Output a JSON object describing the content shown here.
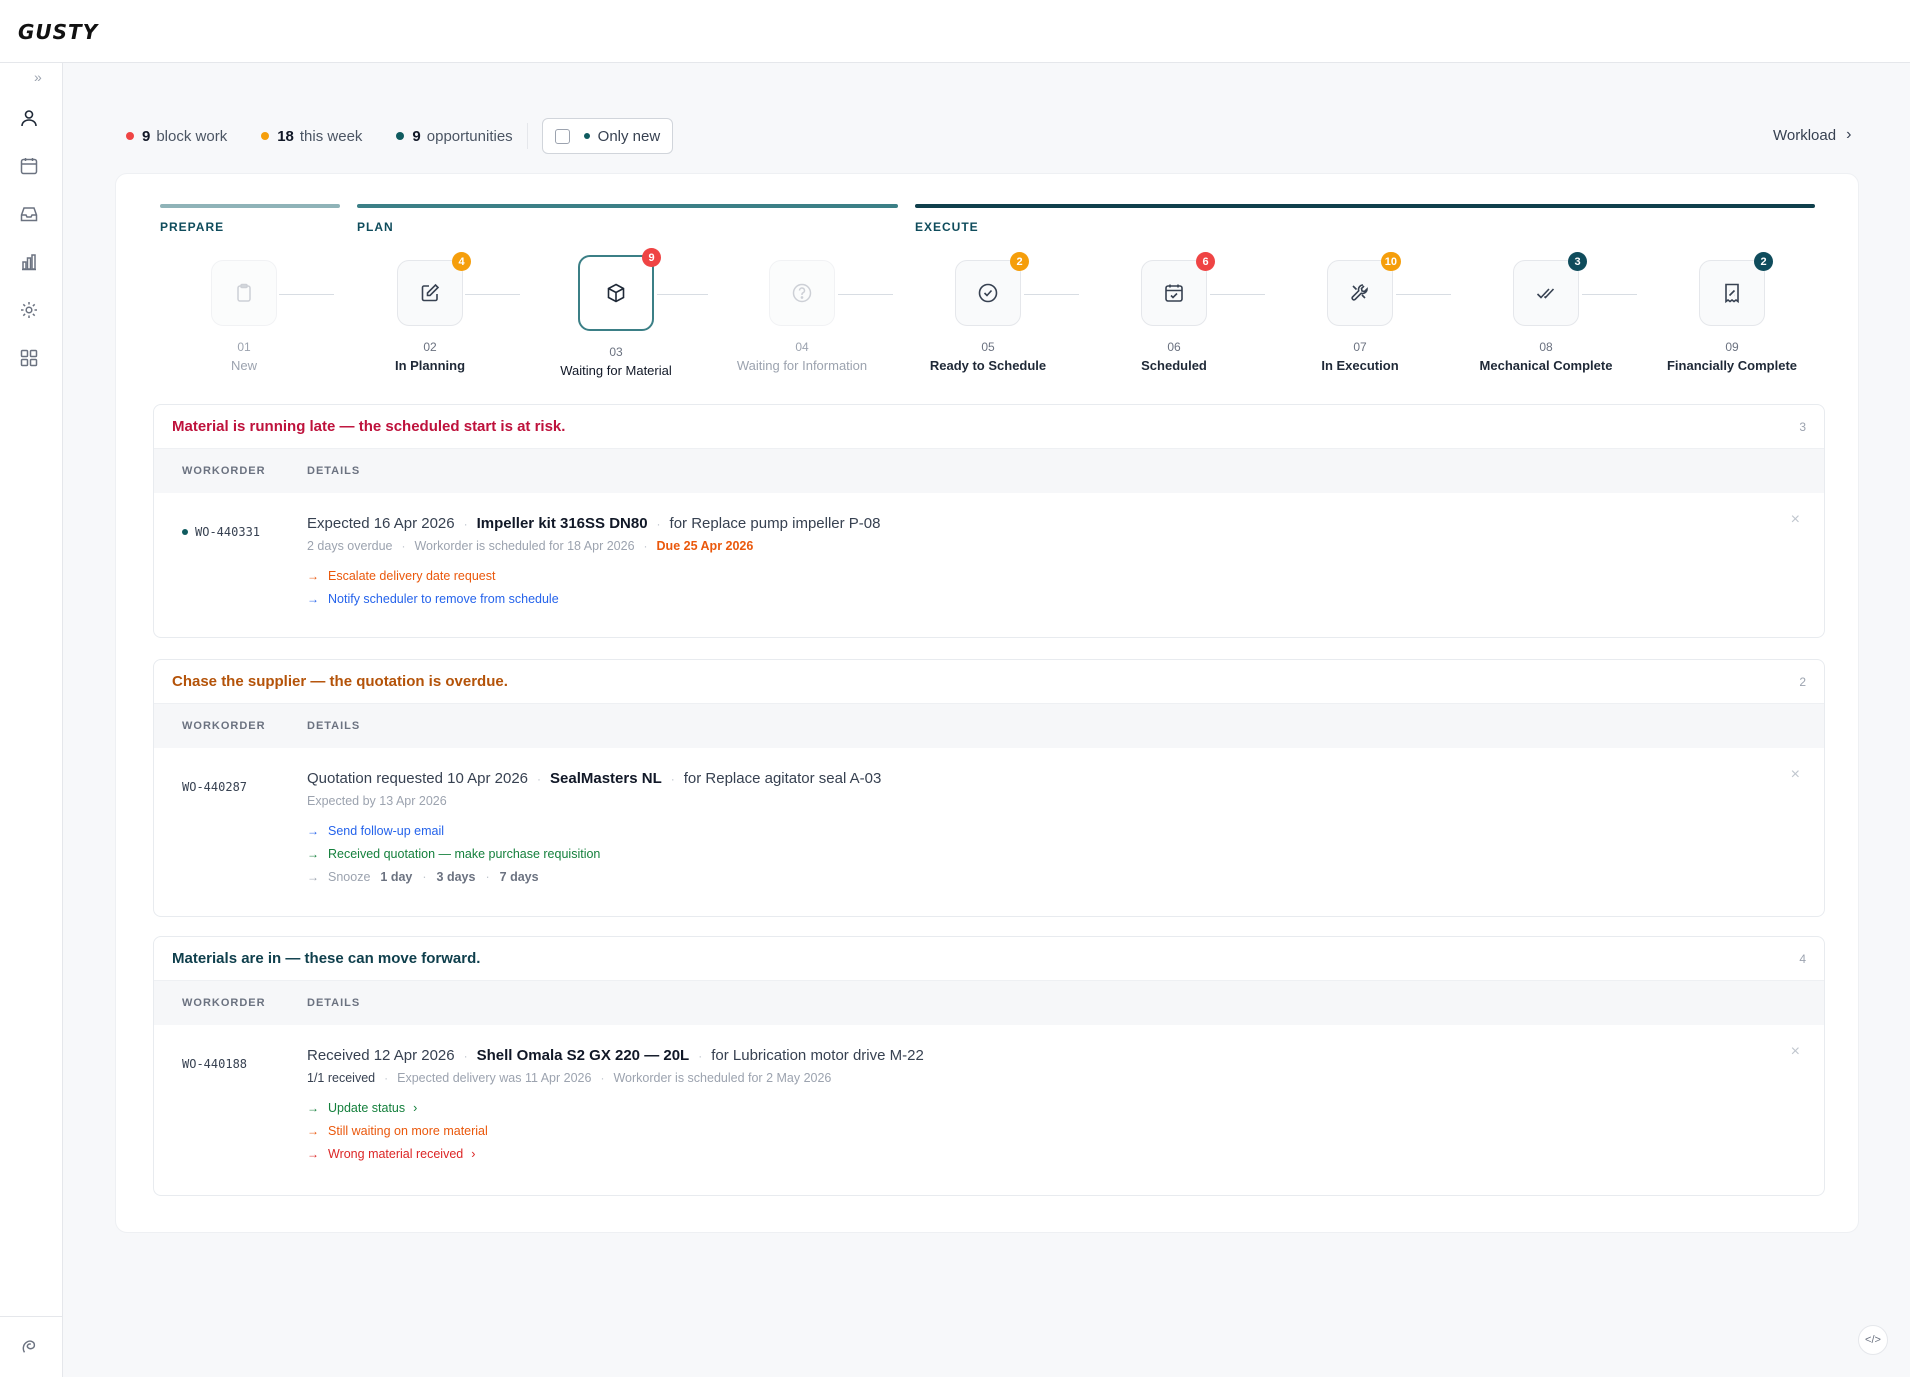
{
  "app": {
    "logo": "GUSTY"
  },
  "sidebar": {
    "expand_glyph": "»",
    "items": [
      {
        "name": "user-icon"
      },
      {
        "name": "calendar-icon"
      },
      {
        "name": "inbox-icon"
      },
      {
        "name": "chart-icon"
      },
      {
        "name": "gear-icon"
      },
      {
        "name": "grid-icon"
      }
    ],
    "bottom_icon": "brand-swirl-icon"
  },
  "stats": {
    "block_work": {
      "count": "9",
      "label": "block work",
      "color": "#ef4444"
    },
    "this_week": {
      "count": "18",
      "label": "this week",
      "color": "#f59e0b"
    },
    "opportunities": {
      "count": "9",
      "label": "opportunities",
      "color": "#0f5b5f"
    },
    "only_new": "Only new",
    "workload": "Workload",
    "workload_chevron": "›"
  },
  "phases": {
    "prepare": "PREPARE",
    "plan": "PLAN",
    "execute": "EXECUTE"
  },
  "stages": [
    {
      "num": "01",
      "label": "New",
      "badge": ""
    },
    {
      "num": "02",
      "label": "In Planning",
      "badge": "4"
    },
    {
      "num": "03",
      "label": "Waiting for Material",
      "badge": "9"
    },
    {
      "num": "04",
      "label": "Waiting for Information",
      "badge": ""
    },
    {
      "num": "05",
      "label": "Ready to Schedule",
      "badge": "2"
    },
    {
      "num": "06",
      "label": "Scheduled",
      "badge": "6"
    },
    {
      "num": "07",
      "label": "In Execution",
      "badge": "10"
    },
    {
      "num": "08",
      "label": "Mechanical Complete",
      "badge": "3"
    },
    {
      "num": "09",
      "label": "Financially Complete",
      "badge": "2"
    }
  ],
  "columns": {
    "workorder": "WORKORDER",
    "details": "DETAILS"
  },
  "sections": [
    {
      "title": "Material is running late — the scheduled start is at risk.",
      "count": "3",
      "row": {
        "wo": "WO-440331",
        "expected": "Expected 16 Apr 2026",
        "item": "Impeller kit 316SS DN80",
        "for": "for Replace pump impeller P-08",
        "overdue": "2 days overdue",
        "scheduled": "Workorder is scheduled for 18 Apr 2026",
        "due": "Due 25 Apr 2026",
        "actions": [
          "Escalate delivery date request",
          "Notify scheduler to remove from schedule"
        ]
      }
    },
    {
      "title": "Chase the supplier — the quotation is overdue.",
      "count": "2",
      "row": {
        "wo": "WO-440287",
        "requested": "Quotation requested 10 Apr 2026",
        "supplier": "SealMasters NL",
        "for": "for Replace agitator seal A-03",
        "expected_by": "Expected by 13 Apr 2026",
        "actions": [
          "Send follow-up email",
          "Received quotation — make purchase requisition"
        ],
        "snooze": "Snooze",
        "snooze_options": [
          "1 day",
          "3 days",
          "7 days"
        ]
      }
    },
    {
      "title": "Materials are in — these can move forward.",
      "count": "4",
      "row": {
        "wo": "WO-440188",
        "received": "Received 12 Apr 2026",
        "item": "Shell Omala S2 GX 220 — 20L",
        "for": "for Lubrication motor drive M-22",
        "received_count": "1/1 received",
        "expected_delivery": "Expected delivery was 11 Apr 2026",
        "scheduled": "Workorder is scheduled for 2 May 2026",
        "actions": [
          "Update status",
          "Still waiting on more material",
          "Wrong material received"
        ]
      }
    }
  ],
  "misc": {
    "dismiss": "×",
    "arrow": "→",
    "chevron": "›",
    "code": "</>"
  },
  "colors": {
    "accent": "#0f4c5c",
    "danger": "#be123c",
    "warning": "#b45309",
    "success": "#15803d",
    "link": "#2563eb",
    "orange": "#ea580c",
    "red": "#dc2626"
  }
}
